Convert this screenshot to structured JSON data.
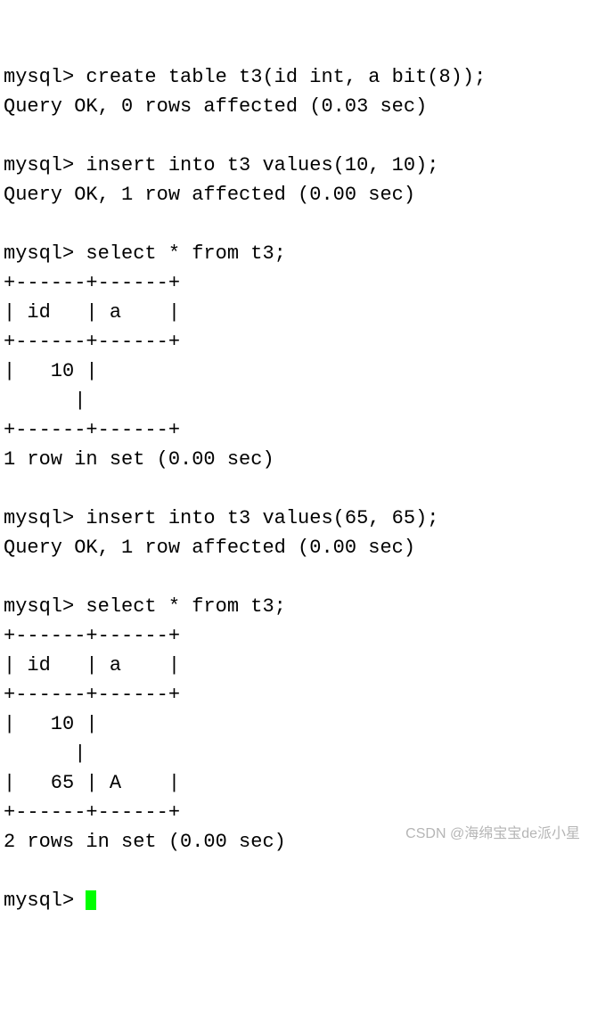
{
  "lines": {
    "l01": "mysql> create table t3(id int, a bit(8));",
    "l02": "Query OK, 0 rows affected (0.03 sec)",
    "l03": "",
    "l04": "mysql> insert into t3 values(10, 10);",
    "l05": "Query OK, 1 row affected (0.00 sec)",
    "l06": "",
    "l07": "mysql> select * from t3;",
    "l08": "+------+------+",
    "l09": "| id   | a    |",
    "l10": "+------+------+",
    "l11": "|   10 |",
    "l12": "      |",
    "l13": "+------+------+",
    "l14": "1 row in set (0.00 sec)",
    "l15": "",
    "l16": "mysql> insert into t3 values(65, 65);",
    "l17": "Query OK, 1 row affected (0.00 sec)",
    "l18": "",
    "l19": "mysql> select * from t3;",
    "l20": "+------+------+",
    "l21": "| id   | a    |",
    "l22": "+------+------+",
    "l23": "|   10 |",
    "l24": "      |",
    "l25": "|   65 | A    |",
    "l26": "+------+------+",
    "l27": "2 rows in set (0.00 sec)",
    "l28": "",
    "l29": "mysql> "
  },
  "watermark": "CSDN @海绵宝宝de派小星"
}
